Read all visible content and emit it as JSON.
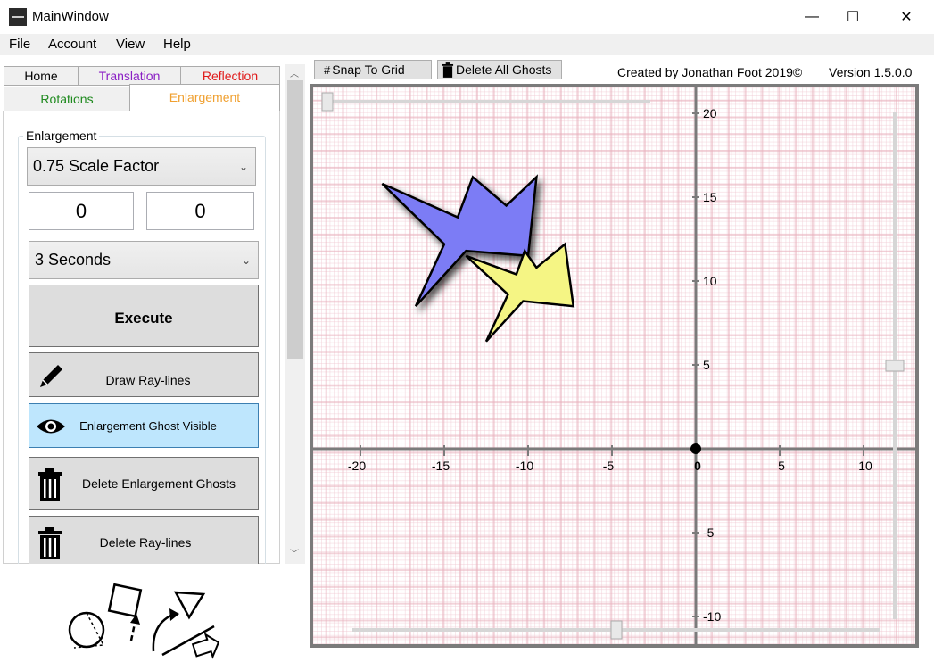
{
  "window": {
    "title": "MainWindow",
    "minimize_glyph": "—",
    "maximize_glyph": "☐",
    "close_glyph": "✕"
  },
  "menu": [
    "File",
    "Account",
    "View",
    "Help"
  ],
  "tabs": {
    "row1": [
      {
        "label": "Home",
        "color": "#000000"
      },
      {
        "label": "Translation",
        "color": "#8a1fc4"
      },
      {
        "label": "Reflection",
        "color": "#e01b1b"
      }
    ],
    "row2": [
      {
        "label": "Rotations",
        "color": "#1f8a1f"
      },
      {
        "label": "Enlargement",
        "color": "#f0a030"
      }
    ],
    "selected": "Enlargement"
  },
  "enlargement": {
    "group_label": "Enlargement",
    "scale_factor": "0.75 Scale Factor",
    "center_x": "0",
    "center_y": "0",
    "duration": "3 Seconds",
    "execute_label": "Execute",
    "draw_raylines_label": "Draw Ray-lines",
    "ghost_visible_label": "Enlargement Ghost Visible",
    "delete_ghosts_label": "Delete Enlargement Ghosts",
    "delete_raylines_label": "Delete Ray-lines"
  },
  "toolbar": {
    "snap_label": "Snap To Grid",
    "delete_all_label": "Delete All Ghosts",
    "credit": "Created by Jonathan Foot 2019©",
    "version": "Version 1.5.0.0"
  },
  "colors": {
    "original_shape": "#7b7bf5",
    "ghost_shape": "#f5f584",
    "ghost_button_bg": "#bee6fd"
  },
  "chart_data": {
    "type": "scatter",
    "x_ticks": [
      "-20",
      "-15",
      "-10",
      "-5",
      "0",
      "5",
      "10"
    ],
    "y_ticks": [
      "20",
      "15",
      "10",
      "5",
      "-5",
      "-10"
    ],
    "xlim": [
      -23,
      12
    ],
    "ylim": [
      -12,
      21
    ],
    "origin_point": [
      0,
      0
    ],
    "shapes": [
      {
        "name": "original",
        "color": "#7b7bf5",
        "points": [
          [
            -18.7,
            15.8
          ],
          [
            -15,
            12.2
          ],
          [
            -16.7,
            8.5
          ],
          [
            -13.7,
            11.8
          ],
          [
            -10,
            11.5
          ],
          [
            -9.5,
            16.2
          ],
          [
            -11.3,
            14.5
          ],
          [
            -13.3,
            16.2
          ],
          [
            -14.2,
            13.8
          ]
        ]
      },
      {
        "name": "enlargement-ghost",
        "color": "#f5f584",
        "points": [
          [
            -13.7,
            11.5
          ],
          [
            -11.2,
            9.2
          ],
          [
            -12.5,
            6.4
          ],
          [
            -10.3,
            8.8
          ],
          [
            -7.3,
            8.5
          ],
          [
            -7.8,
            12.2
          ],
          [
            -9.5,
            10.8
          ],
          [
            -10.2,
            11.8
          ],
          [
            -10.7,
            10.4
          ]
        ]
      }
    ]
  },
  "sliders": {
    "horizontal_top": 0.0,
    "vertical_right": 0.5,
    "horizontal_bottom": 0.5
  },
  "icons": [
    "pencil-icon",
    "eye-icon",
    "trash-icon",
    "grid-icon",
    "shapes-logo"
  ]
}
